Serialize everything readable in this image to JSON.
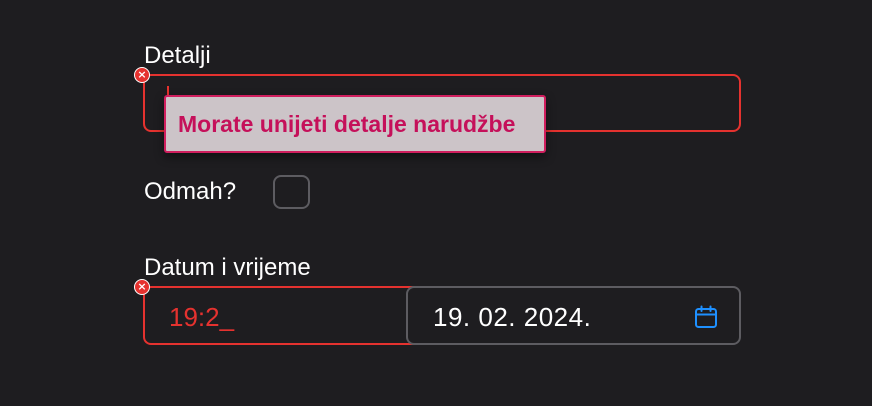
{
  "form": {
    "details": {
      "label": "Detalji",
      "value": "",
      "error_message": "Morate unijeti detalje narudžbe"
    },
    "now": {
      "label": "Odmah?",
      "checked": false
    },
    "datetime": {
      "label": "Datum i vrijeme",
      "time_value": "19:2_",
      "date_value": "19. 02. 2024."
    }
  },
  "colors": {
    "background": "#1e1d20",
    "error": "#e5322f",
    "tooltip_text": "#c5105a",
    "tooltip_bg": "#ccc4c8",
    "accent_icon": "#1e90ff",
    "neutral_border": "#5d5c61"
  },
  "icons": {
    "error": "error-x-icon",
    "calendar": "calendar-icon"
  }
}
